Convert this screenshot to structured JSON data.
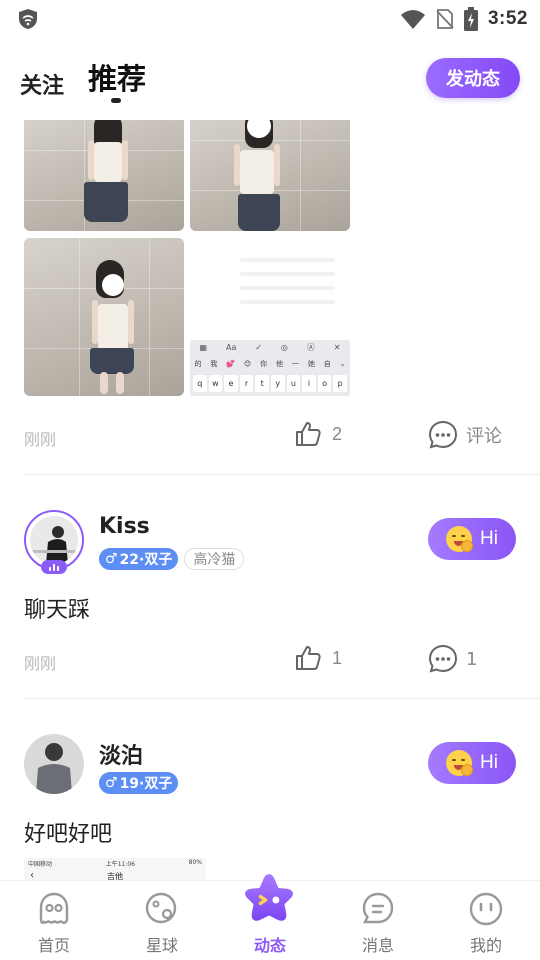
{
  "status_bar": {
    "time": "3:52",
    "icons": [
      "shield-wifi-icon",
      "wifi-icon",
      "no-sim-icon",
      "battery-charging-icon"
    ]
  },
  "header": {
    "tabs": [
      {
        "label": "关注",
        "active": false
      },
      {
        "label": "推荐",
        "active": true
      }
    ],
    "post_button": "发动态"
  },
  "feed": {
    "post1": {
      "time": "刚刚",
      "likes": "2",
      "comment_label": "评论",
      "keyboard": {
        "toolbar": [
          "▦",
          "Aa",
          "✓",
          "◎",
          "Ⓐ",
          "✕"
        ],
        "candidates": [
          "的",
          "我",
          "💕",
          "😊",
          "你",
          "他",
          "一",
          "她",
          "自",
          "⌄"
        ],
        "keys": [
          "q",
          "w",
          "e",
          "r",
          "t",
          "y",
          "u",
          "i",
          "o",
          "p"
        ]
      }
    },
    "post2": {
      "username": "Kiss",
      "gender_age": "22·双子",
      "tag": "高冷猫",
      "hi_label": "Hi",
      "text": "聊天踩",
      "time": "刚刚",
      "likes": "1",
      "comments": "1"
    },
    "post3": {
      "username": "淡泊",
      "gender_age": "19·双子",
      "hi_label": "Hi",
      "text": "好吧好吧",
      "screenshot": {
        "carrier": "中国移动",
        "time": "上午11:06",
        "battery": "80%",
        "nav_title": "吉他"
      }
    }
  },
  "bottom_nav": {
    "items": [
      {
        "label": "首页",
        "icon": "ghost-icon",
        "active": false
      },
      {
        "label": "星球",
        "icon": "planet-icon",
        "active": false
      },
      {
        "label": "动态",
        "icon": "star-icon",
        "active": true
      },
      {
        "label": "消息",
        "icon": "chat-bubble-icon",
        "active": false
      },
      {
        "label": "我的",
        "icon": "face-icon",
        "active": false
      }
    ]
  },
  "colors": {
    "accent": "#8c5cf6",
    "gender_tag": "#5c8ef5",
    "muted_text": "#b8b8b8"
  }
}
